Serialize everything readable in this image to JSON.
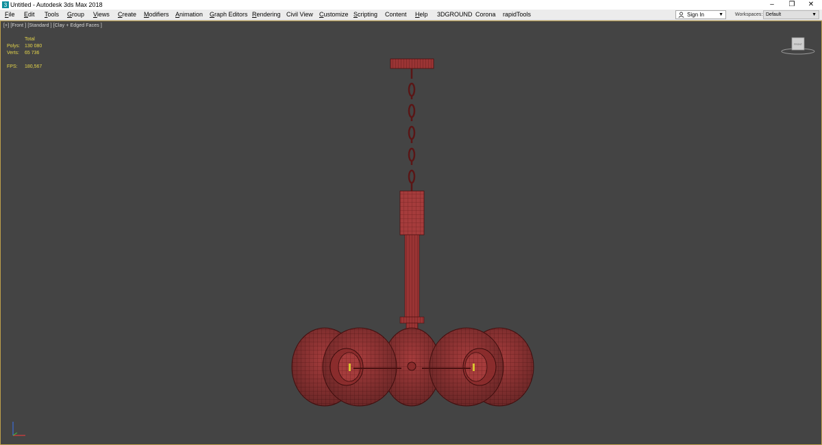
{
  "titlebar": {
    "title": "Untitled - Autodesk 3ds Max 2018",
    "minimize": "–",
    "restore": "❐",
    "close": "✕"
  },
  "menubar": {
    "items": [
      {
        "accel": "F",
        "rest": "ile"
      },
      {
        "accel": "E",
        "rest": "dit"
      },
      {
        "accel": "T",
        "rest": "ools"
      },
      {
        "accel": "G",
        "rest": "roup"
      },
      {
        "accel": "V",
        "rest": "iews"
      },
      {
        "accel": "C",
        "rest": "reate"
      },
      {
        "accel": "M",
        "rest": "odifiers"
      },
      {
        "accel": "A",
        "rest": "nimation"
      },
      {
        "accel": "G",
        "rest": "raph Editors"
      },
      {
        "accel": "R",
        "rest": "endering"
      },
      {
        "accel": "",
        "rest": "Civil View"
      },
      {
        "accel": "C",
        "rest": "ustomize"
      },
      {
        "accel": "S",
        "rest": "cripting"
      },
      {
        "accel": "",
        "rest": "Content"
      },
      {
        "accel": "H",
        "rest": "elp"
      },
      {
        "accel": "",
        "rest": "3DGROUND"
      },
      {
        "accel": "",
        "rest": "Corona"
      },
      {
        "accel": "",
        "rest": "rapidTools"
      }
    ],
    "signin_label": "Sign In",
    "workspaces_label": "Workspaces:",
    "workspaces_value": "Default"
  },
  "viewport": {
    "label": "[+] [Front ] [Standard ] [Clay + Edged Faces ]",
    "stats": {
      "header": "Total",
      "polys_label": "Polys:",
      "polys_value": "130 080",
      "verts_label": "Verts:",
      "verts_value": "65 736",
      "fps_label": "FPS:",
      "fps_value": "180,567"
    },
    "viewcube_text": "FRONT"
  },
  "colors": {
    "viewport_bg": "#444444",
    "model_fill": "#a53c3c",
    "model_wire": "#5a1616",
    "stats_text": "#e6d64a",
    "active_border": "#c0a24c"
  },
  "icons": [
    "app-icon",
    "user-icon",
    "chevron-down-icon",
    "viewcube-icon",
    "axis-tripod-icon"
  ]
}
